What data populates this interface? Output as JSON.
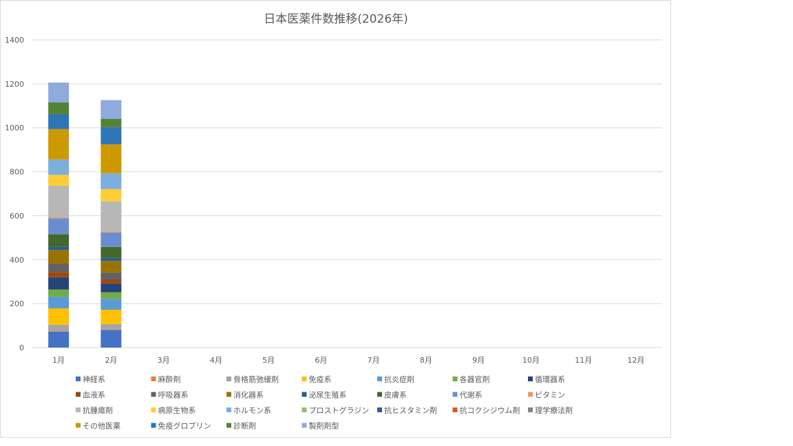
{
  "chart_data": {
    "type": "bar",
    "stacked": true,
    "title": "日本医薬件数推移(2026年)",
    "xlabel": "",
    "ylabel": "",
    "ylim": [
      0,
      1400
    ],
    "yticks": [
      "0",
      "200",
      "400",
      "600",
      "800",
      "1000",
      "1200",
      "1400"
    ],
    "grid": true,
    "legend_position": "bottom",
    "categories": [
      "1月",
      "2月",
      "3月",
      "4月",
      "5月",
      "6月",
      "7月",
      "8月",
      "9月",
      "10月",
      "11月",
      "12月"
    ],
    "series": [
      {
        "name": "神経系",
        "color": "#4472C4",
        "values": [
          72,
          80,
          0,
          0,
          0,
          0,
          0,
          0,
          0,
          0,
          0,
          0
        ]
      },
      {
        "name": "麻酔剤",
        "color": "#ED7D31",
        "values": [
          2,
          2,
          0,
          0,
          0,
          0,
          0,
          0,
          0,
          0,
          0,
          0
        ]
      },
      {
        "name": "骨格筋弛緩剤",
        "color": "#A5A5A5",
        "values": [
          30,
          25,
          0,
          0,
          0,
          0,
          0,
          0,
          0,
          0,
          0,
          0
        ]
      },
      {
        "name": "免疫系",
        "color": "#FFC000",
        "values": [
          74,
          65,
          0,
          0,
          0,
          0,
          0,
          0,
          0,
          0,
          0,
          0
        ]
      },
      {
        "name": "抗炎症剤",
        "color": "#5B9BD5",
        "values": [
          54,
          50,
          0,
          0,
          0,
          0,
          0,
          0,
          0,
          0,
          0,
          0
        ]
      },
      {
        "name": "各器官剤",
        "color": "#70AD47",
        "values": [
          32,
          30,
          0,
          0,
          0,
          0,
          0,
          0,
          0,
          0,
          0,
          0
        ]
      },
      {
        "name": "循環器系",
        "color": "#264478",
        "values": [
          56,
          40,
          0,
          0,
          0,
          0,
          0,
          0,
          0,
          0,
          0,
          0
        ]
      },
      {
        "name": "血液系",
        "color": "#9E480E",
        "values": [
          24,
          18,
          0,
          0,
          0,
          0,
          0,
          0,
          0,
          0,
          0,
          0
        ]
      },
      {
        "name": "呼吸器系",
        "color": "#636363",
        "values": [
          38,
          32,
          0,
          0,
          0,
          0,
          0,
          0,
          0,
          0,
          0,
          0
        ]
      },
      {
        "name": "消化器系",
        "color": "#997300",
        "values": [
          62,
          52,
          0,
          0,
          0,
          0,
          0,
          0,
          0,
          0,
          0,
          0
        ]
      },
      {
        "name": "泌尿生殖系",
        "color": "#255E91",
        "values": [
          14,
          14,
          0,
          0,
          0,
          0,
          0,
          0,
          0,
          0,
          0,
          0
        ]
      },
      {
        "name": "皮膚系",
        "color": "#43682B",
        "values": [
          58,
          50,
          0,
          0,
          0,
          0,
          0,
          0,
          0,
          0,
          0,
          0
        ]
      },
      {
        "name": "代謝系",
        "color": "#698ED0",
        "values": [
          72,
          66,
          0,
          0,
          0,
          0,
          0,
          0,
          0,
          0,
          0,
          0
        ]
      },
      {
        "name": "ビタミン",
        "color": "#F1975A",
        "values": [
          4,
          4,
          0,
          0,
          0,
          0,
          0,
          0,
          0,
          0,
          0,
          0
        ]
      },
      {
        "name": "抗腫瘍剤",
        "color": "#B7B7B7",
        "values": [
          144,
          138,
          0,
          0,
          0,
          0,
          0,
          0,
          0,
          0,
          0,
          0
        ]
      },
      {
        "name": "病原生物系",
        "color": "#FFCD33",
        "values": [
          50,
          55,
          0,
          0,
          0,
          0,
          0,
          0,
          0,
          0,
          0,
          0
        ]
      },
      {
        "name": "ホルモン系",
        "color": "#7CAFDD",
        "values": [
          70,
          72,
          0,
          0,
          0,
          0,
          0,
          0,
          0,
          0,
          0,
          0
        ]
      },
      {
        "name": "プロストグラジン",
        "color": "#8CC168",
        "values": [
          0,
          0,
          0,
          0,
          0,
          0,
          0,
          0,
          0,
          0,
          0,
          0
        ]
      },
      {
        "name": "抗ヒスタミン剤",
        "color": "#335AA1",
        "values": [
          0,
          0,
          0,
          0,
          0,
          0,
          0,
          0,
          0,
          0,
          0,
          0
        ]
      },
      {
        "name": "抗コクシジウム剤",
        "color": "#D26012",
        "values": [
          0,
          0,
          0,
          0,
          0,
          0,
          0,
          0,
          0,
          0,
          0,
          0
        ]
      },
      {
        "name": "理学療法剤",
        "color": "#848484",
        "values": [
          0,
          0,
          0,
          0,
          0,
          0,
          0,
          0,
          0,
          0,
          0,
          0
        ]
      },
      {
        "name": "その他医薬",
        "color": "#CC9A00",
        "values": [
          138,
          132,
          0,
          0,
          0,
          0,
          0,
          0,
          0,
          0,
          0,
          0
        ]
      },
      {
        "name": "免疫グロブリン",
        "color": "#2E75B6",
        "values": [
          68,
          78,
          0,
          0,
          0,
          0,
          0,
          0,
          0,
          0,
          0,
          0
        ]
      },
      {
        "name": "診断剤",
        "color": "#548235",
        "values": [
          54,
          38,
          0,
          0,
          0,
          0,
          0,
          0,
          0,
          0,
          0,
          0
        ]
      },
      {
        "name": "製剤剤型",
        "color": "#8FAADC",
        "values": [
          90,
          85,
          0,
          0,
          0,
          0,
          0,
          0,
          0,
          0,
          0,
          0
        ]
      }
    ]
  }
}
